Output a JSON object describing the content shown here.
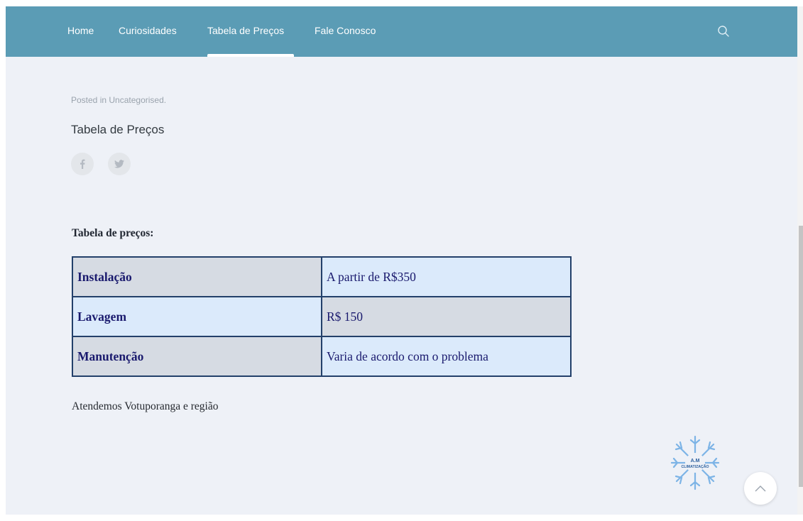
{
  "nav": {
    "items": [
      {
        "label": "Home"
      },
      {
        "label": "Curiosidades"
      },
      {
        "label": "Tabela de Preços",
        "active": true
      },
      {
        "label": "Fale Conosco"
      }
    ],
    "search_icon": "search-icon",
    "color": "#5b9cb5"
  },
  "post": {
    "meta": "Posted in Uncategorised.",
    "title": "Tabela de Preços",
    "share_icons": [
      "facebook-icon",
      "twitter-icon"
    ]
  },
  "content": {
    "heading": "Tabela de preços:",
    "table": [
      {
        "service": "Instalação",
        "price": "A partir de R$350"
      },
      {
        "service": "Lavagem",
        "price": "R$ 150"
      },
      {
        "service": "Manutenção",
        "price": "Varia de acordo com o problema"
      }
    ],
    "note": "Atendemos Votuporanga e região"
  },
  "logo": {
    "text": "A.M CLIMATIZAÇÃO"
  },
  "back_to_top_icon": "chevron-up-icon"
}
